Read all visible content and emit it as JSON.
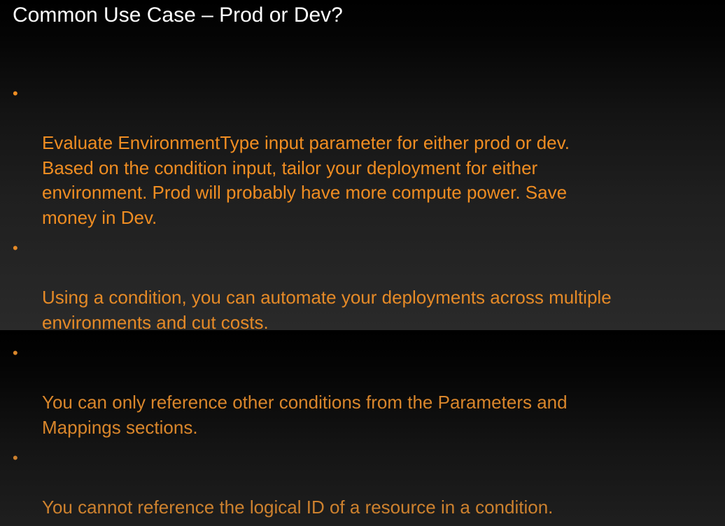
{
  "slide": {
    "title": "Common Use Case – Prod or Dev?",
    "bullet_glyph": "•",
    "bullets": [
      {
        "text": "Evaluate EnvironmentType input parameter for either prod or dev.\nBased on the condition input, tailor your deployment for either\nenvironment. Prod will probably have more compute power. Save\nmoney in Dev.",
        "color": "#ef8d22"
      },
      {
        "text": "Using a condition, you can automate your deployments across multiple\nenvironments and cut costs.",
        "color": "#e58a27"
      },
      {
        "text": "You can only reference other conditions from the Parameters and\nMappings sections.",
        "color": "#d9862b"
      },
      {
        "text": "You cannot reference the logical ID of a resource in a condition.",
        "color": "#cd812e"
      }
    ]
  }
}
